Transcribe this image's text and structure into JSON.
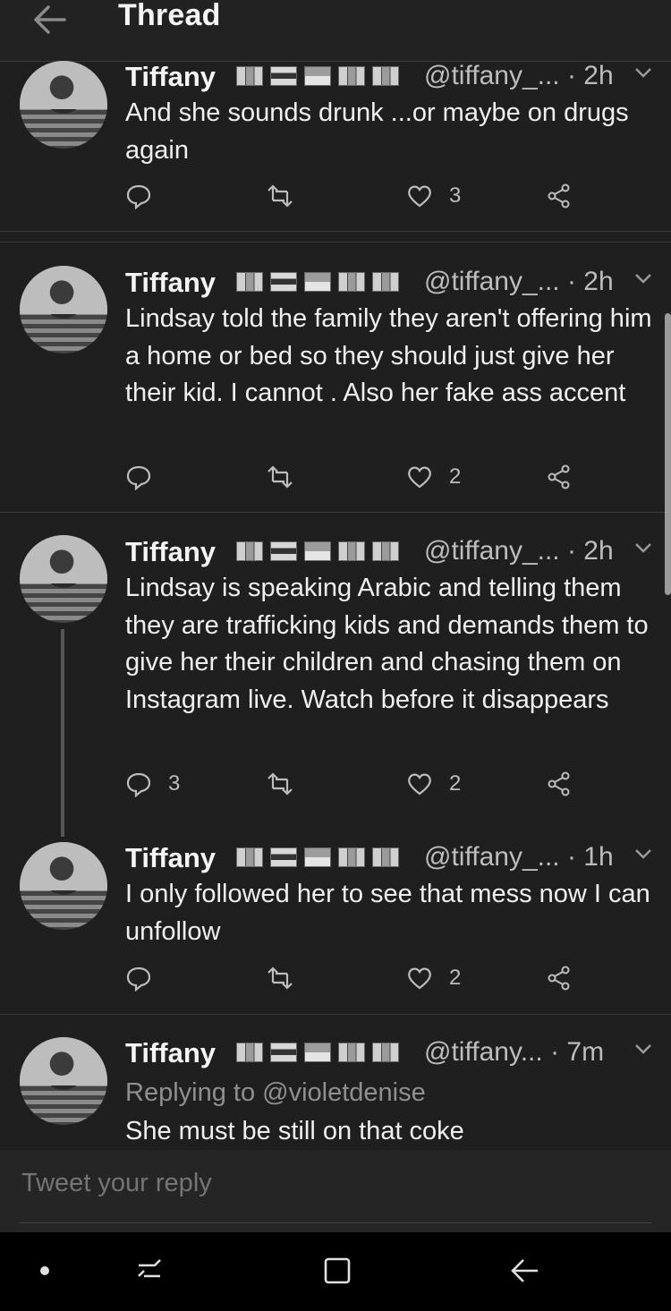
{
  "header": {
    "title": "Thread",
    "back_icon": "arrow-left-icon"
  },
  "tweets": [
    {
      "name": "Tiffany",
      "handle": "@tiffany_...",
      "time": "· 2h",
      "text": "And she sounds drunk ...or maybe on drugs again",
      "replies": "",
      "retweets": "",
      "likes": "3"
    },
    {
      "name": "Tiffany",
      "handle": "@tiffany_...",
      "time": "· 2h",
      "text": "Lindsay told the family they aren't offering him a home or bed so they should just give her their kid. I cannot . Also her fake ass accent",
      "replies": "",
      "retweets": "",
      "likes": "2"
    },
    {
      "name": "Tiffany",
      "handle": "@tiffany_...",
      "time": "· 2h",
      "text": "Lindsay is  speaking Arabic and telling them they are trafficking kids and demands them to give her their children and chasing them on Instagram live. Watch before it disappears",
      "replies": "3",
      "retweets": "",
      "likes": "2"
    },
    {
      "name": "Tiffany",
      "handle": "@tiffany_...",
      "time": "· 1h",
      "text": "I only followed her to see that mess now I can unfollow",
      "replies": "",
      "retweets": "",
      "likes": "2"
    },
    {
      "name": "Tiffany",
      "handle": "@tiffany...",
      "time": "· 7m",
      "replying_to": "Replying to @violetdenise",
      "text": "She must be still on that coke"
    }
  ],
  "reply_box": {
    "placeholder": "Tweet your reply"
  },
  "colors": {
    "background": "#1f1f1f",
    "text": "#f2f2f2",
    "secondary": "#bdbdbd"
  }
}
